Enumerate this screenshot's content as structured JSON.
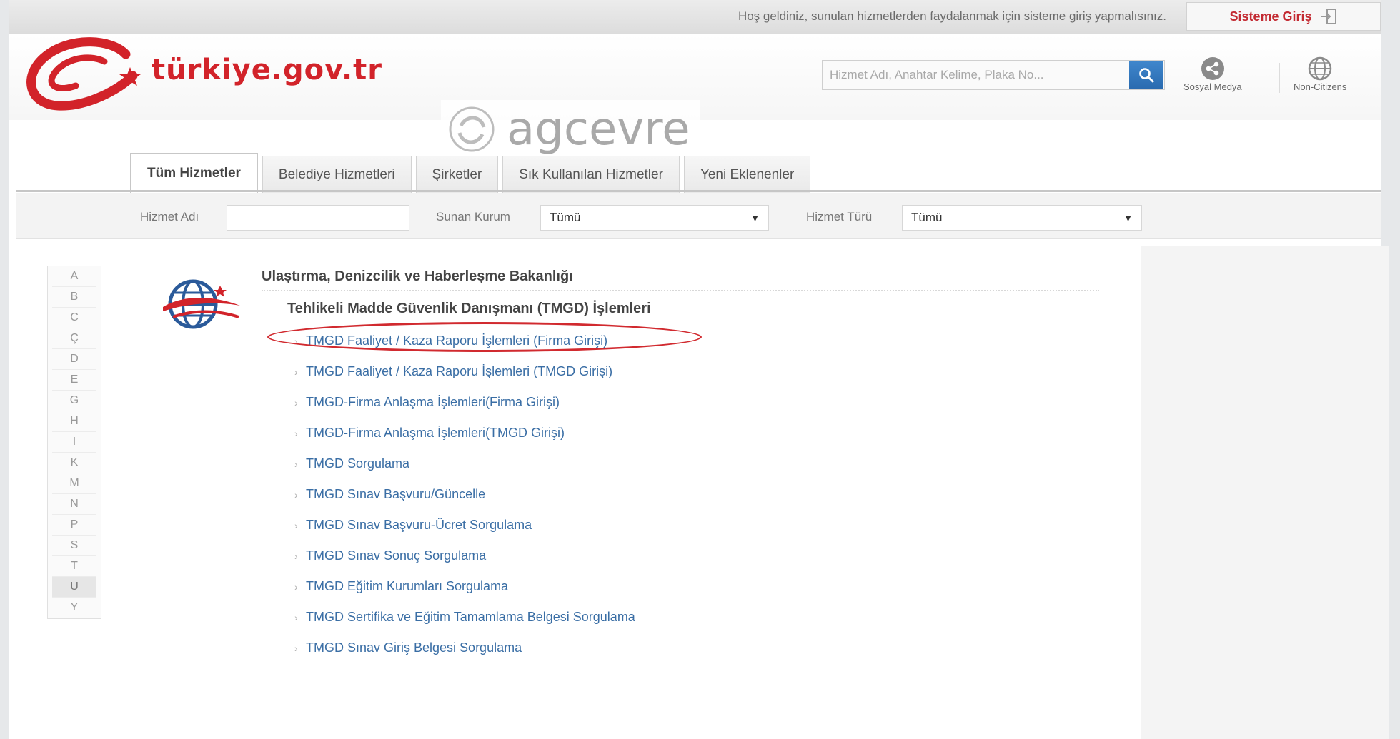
{
  "topbar": {
    "welcome_text": "Hoş geldiniz, sunulan hizmetlerden faydalanmak için sisteme giriş yapmalısınız.",
    "login_label": "Sisteme Giriş"
  },
  "header": {
    "logo_text": "türkiye.gov.tr",
    "search_placeholder": "Hizmet Adı, Anahtar Kelime, Plaka No...",
    "social_label": "Sosyal Medya",
    "noncitizens_label": "Non-Citizens"
  },
  "watermark": {
    "text": "agcevre"
  },
  "tabs": [
    {
      "label": "Tüm Hizmetler",
      "active": true
    },
    {
      "label": "Belediye Hizmetleri",
      "active": false
    },
    {
      "label": "Şirketler",
      "active": false
    },
    {
      "label": "Sık Kullanılan Hizmetler",
      "active": false
    },
    {
      "label": "Yeni Eklenenler",
      "active": false
    }
  ],
  "filters": {
    "service_name_label": "Hizmet Adı",
    "service_name_value": "",
    "provider_label": "Sunan Kurum",
    "provider_value": "Tümü",
    "type_label": "Hizmet Türü",
    "type_value": "Tümü"
  },
  "alphabet": [
    "A",
    "B",
    "C",
    "Ç",
    "D",
    "E",
    "G",
    "H",
    "I",
    "K",
    "M",
    "N",
    "P",
    "S",
    "T",
    "U",
    "Y"
  ],
  "alphabet_active": "U",
  "content": {
    "ministry_title": "Ulaştırma, Denizcilik ve Haberleşme Bakanlığı",
    "group_title": "Tehlikeli Madde Güvenlik Danışmanı (TMGD) İşlemleri",
    "services": [
      "TMGD Faaliyet / Kaza Raporu İşlemleri (Firma Girişi)",
      "TMGD Faaliyet / Kaza Raporu İşlemleri (TMGD Girişi)",
      "TMGD-Firma Anlaşma İşlemleri(Firma Girişi)",
      "TMGD-Firma Anlaşma İşlemleri(TMGD Girişi)",
      "TMGD Sorgulama",
      "TMGD Sınav Başvuru/Güncelle",
      "TMGD Sınav Başvuru-Ücret Sorgulama",
      "TMGD Sınav Sonuç Sorgulama",
      "TMGD Eğitim Kurumları Sorgulama",
      "TMGD Sertifika ve Eğitim Tamamlama Belgesi Sorgulama",
      "TMGD Sınav Giriş Belgesi Sorgulama"
    ],
    "highlighted_service_index": 0
  },
  "icons": {
    "login": "login-door-icon",
    "search": "magnifier-icon",
    "social": "share-icon",
    "noncitizens": "globe-icon",
    "dropdown": "triangle-down-icon"
  },
  "colors": {
    "brand_red": "#d2232a",
    "link_blue": "#3a6ea5",
    "search_blue": "#2f76bf"
  }
}
